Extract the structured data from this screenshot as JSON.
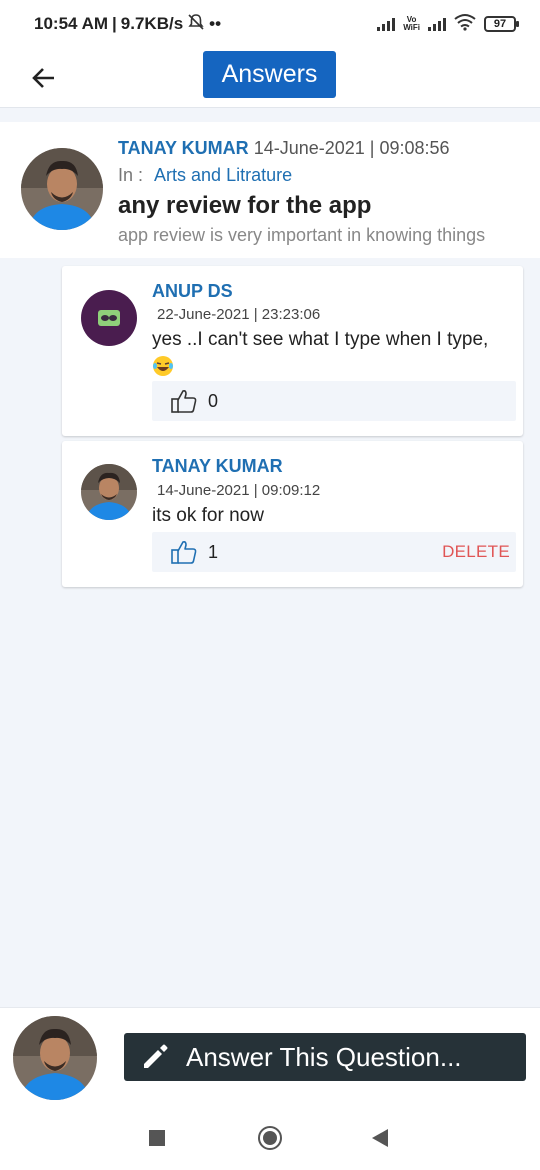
{
  "status_bar": {
    "time": "10:54 AM",
    "speed": "9.7KB/s",
    "dots": "••",
    "vowifi_top": "Vo",
    "vowifi_bottom": "WiFi",
    "battery": "97"
  },
  "header": {
    "title": "Answers"
  },
  "question": {
    "author": "TANAY KUMAR",
    "date": "14-June-2021 | 09:08:56",
    "in_label": "In :",
    "category": "Arts and Litrature",
    "title": "any review for the app",
    "description": "app review is very important in knowing things"
  },
  "answers": [
    {
      "author": "ANUP DS",
      "date": "22-June-2021 | 23:23:06",
      "text": "yes ..I can't see what I type when I type,",
      "likes": "0"
    },
    {
      "author": "TANAY KUMAR",
      "date": "14-June-2021 | 09:09:12",
      "text": "its ok for now",
      "likes": "1",
      "delete_label": "DELETE"
    }
  ],
  "bottom_bar": {
    "answer_button_label": "Answer This Question..."
  },
  "colors": {
    "accent": "#1565c0",
    "name_blue": "#1f6fb2",
    "delete_red": "#e05555",
    "button_dark": "#263238",
    "background": "#f2f5fa"
  },
  "icons": [
    "back-arrow-icon",
    "thumbs-up-icon",
    "pencil-icon",
    "laughing-emoji-icon",
    "signal-icon",
    "wifi-icon",
    "battery-icon",
    "mute-icon"
  ]
}
